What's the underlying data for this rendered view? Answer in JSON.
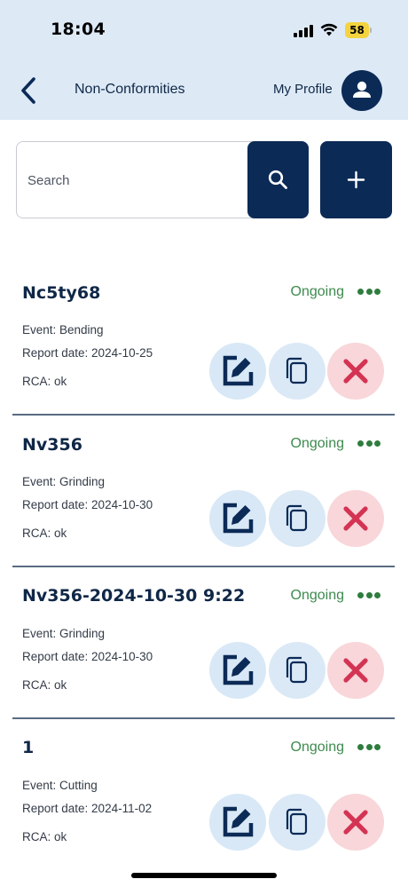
{
  "status_bar": {
    "time": "18:04",
    "battery": "58"
  },
  "header": {
    "title": "Non-Conformities",
    "profile_label": "My Profile"
  },
  "search": {
    "placeholder": "Search",
    "value": ""
  },
  "items": [
    {
      "title": "Nc5ty68",
      "status": "Ongoing",
      "event": "Event: Bending",
      "report_date": "Report date: 2024-10-25",
      "rca": "RCA:  ok"
    },
    {
      "title": "Nv356",
      "status": "Ongoing",
      "event": "Event: Grinding",
      "report_date": "Report date: 2024-10-30",
      "rca": "RCA:  ok"
    },
    {
      "title": "Nv356-2024-10-30 9:22",
      "status": "Ongoing",
      "event": "Event: Grinding",
      "report_date": "Report date: 2024-10-30",
      "rca": "RCA:  ok"
    },
    {
      "title": "1",
      "status": "Ongoing",
      "event": "Event: Cutting",
      "report_date": "Report date: 2024-11-02",
      "rca": "RCA:  ok"
    }
  ],
  "icons": {
    "back": "chevron-left-icon",
    "profile": "user-icon",
    "search": "search-icon",
    "add": "plus-icon",
    "more": "more-horizontal-icon",
    "edit": "edit-icon",
    "copy": "copy-icon",
    "delete": "close-icon"
  },
  "colors": {
    "primary": "#0b2a56",
    "header_bg": "#ddeaf6",
    "status_ongoing": "#3d8a4e",
    "edit_bg": "#d8e8f6",
    "delete_bg": "#f8d6da",
    "delete_icon": "#d43454"
  }
}
